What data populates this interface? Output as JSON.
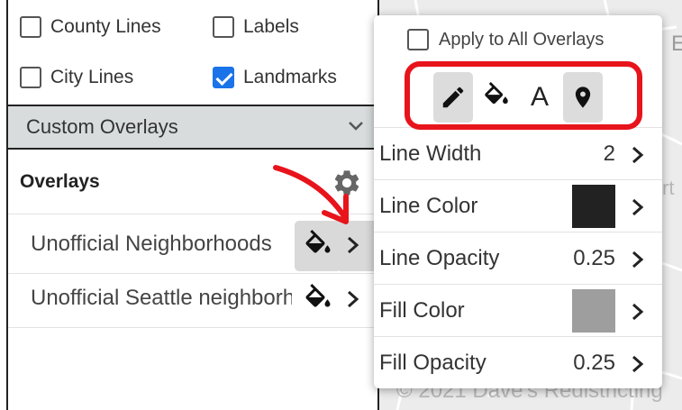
{
  "left_panel": {
    "checkboxes": [
      {
        "label": "County Lines",
        "checked": false
      },
      {
        "label": "Labels",
        "checked": false
      },
      {
        "label": "City Lines",
        "checked": false
      },
      {
        "label": "Landmarks",
        "checked": true
      }
    ],
    "section_header": "Custom Overlays",
    "overlays_title": "Overlays",
    "overlays": [
      {
        "name": "Unofficial Neighborhoods",
        "fill_icon_active": true
      },
      {
        "name": "Unofficial Seattle neighborhoods",
        "fill_icon_active": false
      }
    ]
  },
  "map": {
    "credit": "© 2021 Dave's Redistricting",
    "label_e": "E",
    "label_rt": "rt"
  },
  "style_popup": {
    "apply_all_label": "Apply to All Overlays",
    "apply_all_checked": false,
    "tools": [
      {
        "icon": "pencil-icon",
        "active": true
      },
      {
        "icon": "fill-bucket-icon",
        "active": false
      },
      {
        "icon": "text-a-icon",
        "glyph": "A",
        "active": false
      },
      {
        "icon": "map-marker-icon",
        "active": true
      }
    ],
    "properties": [
      {
        "label": "Line Width",
        "value": "2"
      },
      {
        "label": "Line Color",
        "swatch": "#222222"
      },
      {
        "label": "Line Opacity",
        "value": "0.25"
      },
      {
        "label": "Fill Color",
        "swatch": "#9e9e9e"
      },
      {
        "label": "Fill Opacity",
        "value": "0.25"
      }
    ]
  },
  "colors": {
    "checkbox_checked": "#1a73e8",
    "annotation_red": "#e8141b",
    "header_bg": "#d8dcdd"
  }
}
